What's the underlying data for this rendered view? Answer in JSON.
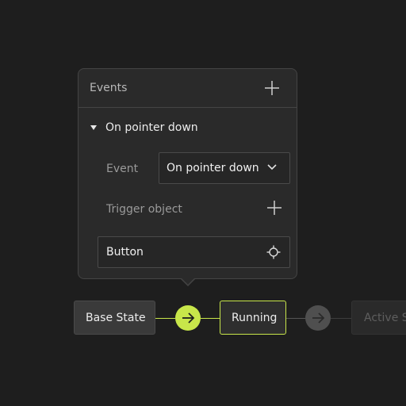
{
  "events_panel": {
    "title": "Events",
    "group_label": "On pointer down",
    "event_label": "Event",
    "event_value": "On pointer down",
    "trigger_label": "Trigger object",
    "trigger_value": "Button"
  },
  "flow": {
    "nodes": [
      {
        "label": "Base State",
        "state": "default"
      },
      {
        "label": "Running",
        "state": "selected"
      },
      {
        "label": "Active State",
        "state": "inactive"
      }
    ],
    "transitions": [
      {
        "icon": "arrow-right-icon",
        "state": "active"
      },
      {
        "icon": "arrow-right-icon",
        "state": "inactive"
      }
    ]
  },
  "colors": {
    "background": "#1e1e1e",
    "panel": "#2a2a2a",
    "accent": "#c8e64a",
    "inactive": "#4f4f4f"
  }
}
